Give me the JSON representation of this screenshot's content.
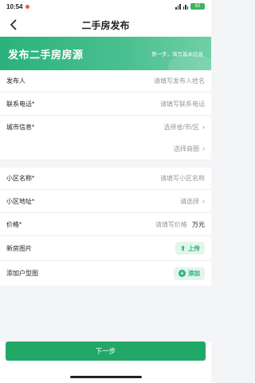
{
  "status": {
    "time": "10:54",
    "battery": "92"
  },
  "nav": {
    "title": "二手房发布"
  },
  "banner": {
    "title": "发布二手房房源",
    "step": "第一步，填写基本信息"
  },
  "form": {
    "publisher": {
      "label": "发布人",
      "placeholder": "请填写发布人姓名"
    },
    "phone": {
      "label": "联系电话*",
      "placeholder": "请填写联系电话"
    },
    "city": {
      "label": "城市信息*",
      "placeholder": "选择省/市/区"
    },
    "district": {
      "placeholder": "选择商圈"
    },
    "community": {
      "label": "小区名称*",
      "placeholder": "请填写小区名称"
    },
    "address": {
      "label": "小区地址*",
      "placeholder": "请选择"
    },
    "price": {
      "label": "价格*",
      "placeholder": "请填写价格",
      "unit": "万元"
    },
    "photos": {
      "label": "新房图片",
      "button": "上传"
    },
    "floorplan": {
      "label": "添加户型图",
      "button": "添加"
    }
  },
  "footer": {
    "next": "下一步"
  },
  "colors": {
    "accent": "#2ab27b",
    "button": "#22a866"
  }
}
